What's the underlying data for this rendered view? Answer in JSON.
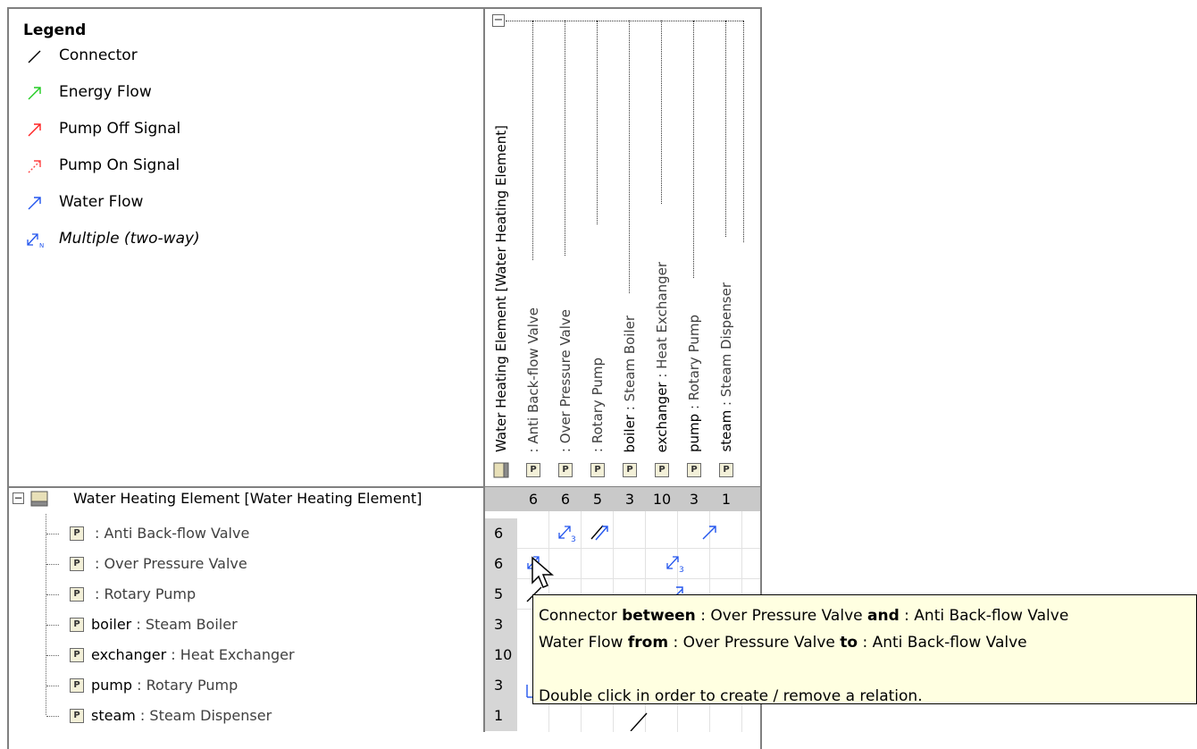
{
  "legend": {
    "title": "Legend",
    "items": [
      {
        "label": "Connector",
        "icon": "connector-icon",
        "color": "#000000"
      },
      {
        "label": "Energy Flow",
        "icon": "energy-flow-icon",
        "color": "#22cc22"
      },
      {
        "label": "Pump Off Signal",
        "icon": "pump-off-signal-icon",
        "color": "#ff2222"
      },
      {
        "label": "Pump On Signal",
        "icon": "pump-on-signal-icon",
        "color": "#ff4444"
      },
      {
        "label": "Water Flow",
        "icon": "water-flow-icon",
        "color": "#2255ee"
      },
      {
        "label": "Multiple (two-way)",
        "icon": "multiple-two-way-icon",
        "color": "#2255ee"
      }
    ]
  },
  "columns": [
    {
      "name": "Water Heating Element [Water Heating Element]",
      "type": "",
      "icon": "block-icon",
      "count": "6"
    },
    {
      "name": "",
      "type": " : Anti Back-flow Valve",
      "icon": "part-icon",
      "count": "6"
    },
    {
      "name": "",
      "type": " : Over Pressure Valve",
      "icon": "part-icon",
      "count": "5"
    },
    {
      "name": "",
      "type": " : Rotary Pump",
      "icon": "part-icon",
      "count": "3"
    },
    {
      "name": "boiler",
      "type": " : Steam Boiler",
      "icon": "part-icon",
      "count": "10"
    },
    {
      "name": "exchanger",
      "type": " : Heat Exchanger",
      "icon": "part-icon",
      "count": "3"
    },
    {
      "name": "pump",
      "type": " : Rotary Pump",
      "icon": "part-icon",
      "count": "1"
    },
    {
      "name": "steam",
      "type": " : Steam Dispenser",
      "icon": "part-icon",
      "count": ""
    }
  ],
  "count_row_label": "6",
  "rows": [
    {
      "name": "Water Heating Element [Water Heating Element]",
      "type": "",
      "count": "",
      "root": true
    },
    {
      "name": "",
      "type": " : Anti Back-flow Valve",
      "count": "6"
    },
    {
      "name": "",
      "type": " : Over Pressure Valve",
      "count": "6"
    },
    {
      "name": "",
      "type": " : Rotary Pump",
      "count": "5"
    },
    {
      "name": "boiler",
      "type": " : Steam Boiler",
      "count": "3"
    },
    {
      "name": "exchanger",
      "type": " : Heat Exchanger",
      "count": "10"
    },
    {
      "name": "pump",
      "type": " : Rotary Pump",
      "count": "3"
    },
    {
      "name": "steam",
      "type": " : Steam Dispenser",
      "count": "1"
    }
  ],
  "cells": {
    "multiple_count": "3",
    "multiple_letter": "N"
  },
  "part_tag": "P",
  "collapse_symbol": "−",
  "tooltip": {
    "line1_a": "Connector ",
    "line1_b": "between",
    "line1_c": " : Over Pressure Valve ",
    "line1_d": "and",
    "line1_e": " : Anti Back-flow Valve",
    "line2_a": "Water Flow ",
    "line2_b": "from",
    "line2_c": " : Over Pressure Valve ",
    "line2_d": "to",
    "line2_e": " : Anti Back-flow Valve",
    "line3": "Double click in order to create / remove a relation."
  }
}
